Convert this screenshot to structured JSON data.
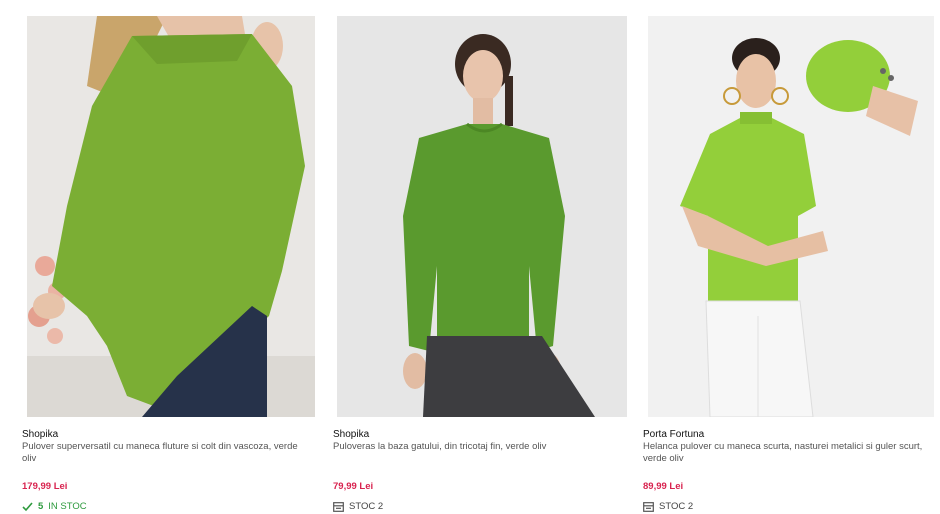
{
  "products": [
    {
      "brand": "Shopika",
      "title": "Pulover superversatil cu maneca fluture si colt din vascoza, verde oliv",
      "price": "179,99 Lei",
      "stock": {
        "count": "5",
        "text": "IN STOC",
        "icon": "check-icon",
        "status": "in-stock"
      }
    },
    {
      "brand": "Shopika",
      "title": "Puloveras la baza gatului, din tricotaj fin, verde oliv",
      "price": "79,99 Lei",
      "stock": {
        "text": "STOC 2",
        "icon": "store-icon",
        "status": "limited"
      }
    },
    {
      "brand": "Porta Fortuna",
      "title": "Helanca pulover cu maneca scurta, nasturei metalici si guler scurt, verde oliv",
      "price": "89,99 Lei",
      "stock": {
        "text": "STOC 2",
        "icon": "store-icon",
        "status": "limited"
      }
    }
  ],
  "colors": {
    "price": "#d8234f",
    "in_stock": "#2e9a3e",
    "sweater_green": "#7bae34"
  }
}
